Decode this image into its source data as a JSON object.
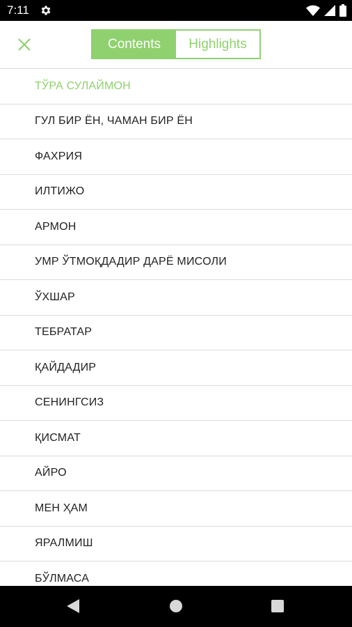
{
  "status_bar": {
    "time": "7:11"
  },
  "app_bar": {
    "tabs": [
      {
        "label": "Contents",
        "active": true
      },
      {
        "label": "Highlights",
        "active": false
      }
    ]
  },
  "colors": {
    "accent": "#8fd16e",
    "text": "#222222",
    "divider": "#dcdcdc"
  },
  "contents": {
    "items": [
      {
        "title": "ТЎРА СУЛАЙМОН",
        "current": true
      },
      {
        "title": "ГУЛ БИР ЁН, ЧАМАН БИР ЁН"
      },
      {
        "title": "ФАХРИЯ"
      },
      {
        "title": "ИЛТИЖО"
      },
      {
        "title": "АРМОН"
      },
      {
        "title": "УМР ЎТМОҚДАДИР ДАРЁ МИСОЛИ"
      },
      {
        "title": "ЎХШАР"
      },
      {
        "title": "ТЕБРАТАР"
      },
      {
        "title": "ҚАЙДАДИР"
      },
      {
        "title": "СЕНИНГСИЗ"
      },
      {
        "title": "ҚИСМАТ"
      },
      {
        "title": "АЙРО"
      },
      {
        "title": "МЕН ҲАМ"
      },
      {
        "title": "ЯРАЛМИШ"
      },
      {
        "title": "БЎЛМАСА"
      }
    ]
  }
}
